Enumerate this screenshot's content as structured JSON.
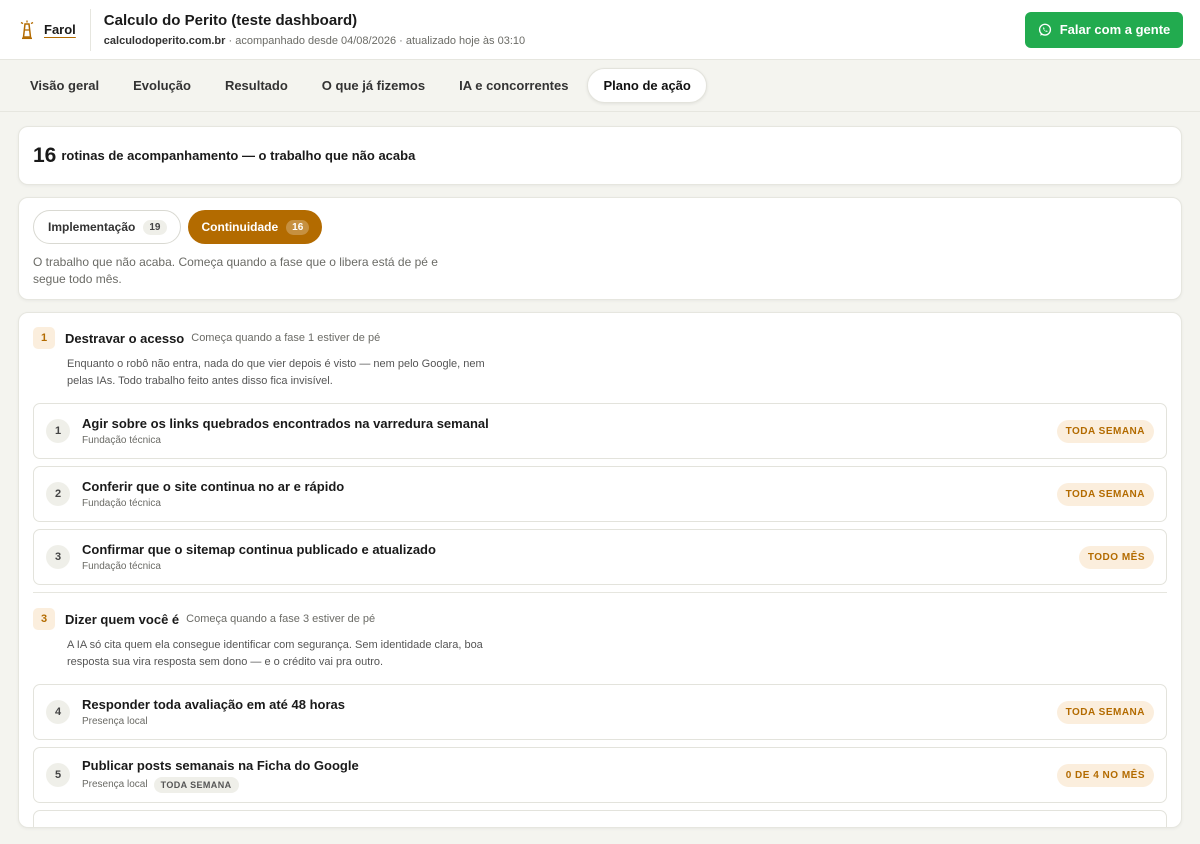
{
  "brand": {
    "name": "Farol",
    "accent": "#b36b00"
  },
  "site": {
    "title": "Calculo do Perito (teste dashboard)",
    "domain": "calculodoperito.com.br",
    "meta": " · acompanhado desde 04/08/2026 · atualizado hoje às 03:10"
  },
  "cta": {
    "label": "Falar com a gente",
    "icon": "whatsapp-icon",
    "color": "#22ab4f"
  },
  "tabs": [
    {
      "label": "Visão geral"
    },
    {
      "label": "Evolução"
    },
    {
      "label": "Resultado"
    },
    {
      "label": "O que já fizemos"
    },
    {
      "label": "IA e concorrentes"
    },
    {
      "label": "Plano de ação",
      "active": true
    }
  ],
  "summary": {
    "count": "16",
    "text": "rotinas de acompanhamento — o trabalho que não acaba"
  },
  "phases": {
    "implementation": {
      "label": "Implementação",
      "count": "19"
    },
    "continuity": {
      "label": "Continuidade",
      "count": "16"
    },
    "description": "O trabalho que não acaba. Começa quando a fase que o libera está de pé e segue todo mês."
  },
  "groups": [
    {
      "number": "1",
      "title": "Destravar o acesso",
      "note": "Começa quando a fase 1 estiver de pé",
      "description": "Enquanto o robô não entra, nada do que vier depois é visto — nem pelo Google, nem pelas IAs. Todo trabalho feito antes disso fica invisível.",
      "items": [
        {
          "number": "1",
          "title": "Agir sobre os links quebrados encontrados na varredura semanal",
          "category": "Fundação técnica",
          "frequency": "TODA SEMANA"
        },
        {
          "number": "2",
          "title": "Conferir que o site continua no ar e rápido",
          "category": "Fundação técnica",
          "frequency": "TODA SEMANA"
        },
        {
          "number": "3",
          "title": "Confirmar que o sitemap continua publicado e atualizado",
          "category": "Fundação técnica",
          "frequency": "TODO MÊS"
        }
      ]
    },
    {
      "number": "3",
      "title": "Dizer quem você é",
      "note": "Começa quando a fase 3 estiver de pé",
      "description": "A IA só cita quem ela consegue identificar com segurança. Sem identidade clara, boa resposta sua vira resposta sem dono — e o crédito vai pra outro.",
      "items": [
        {
          "number": "4",
          "title": "Responder toda avaliação em até 48 horas",
          "category": "Presença local",
          "frequency": "TODA SEMANA"
        },
        {
          "number": "5",
          "title": "Publicar posts semanais na Ficha do Google",
          "category": "Presença local",
          "tag": "TODA SEMANA",
          "frequency": "0 DE 4 NO MÊS"
        }
      ]
    }
  ]
}
